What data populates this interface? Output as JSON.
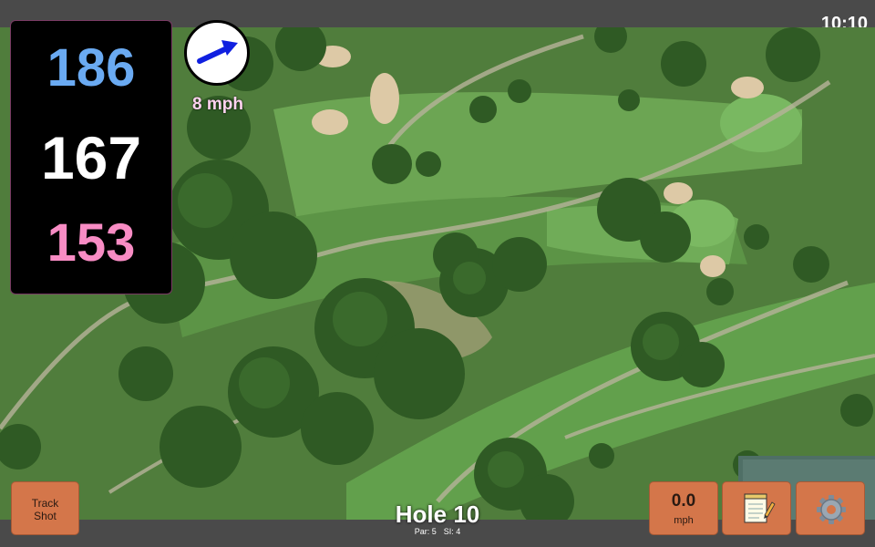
{
  "status_bar": {
    "time": "10:10"
  },
  "distances": {
    "back": "186",
    "middle": "167",
    "front": "153"
  },
  "distance_colors": {
    "back": "#6aaaf2",
    "middle": "#ffffff",
    "front": "#f88cc4"
  },
  "wind": {
    "speed_label": "8 mph",
    "direction_icon": "arrow-icon"
  },
  "hole": {
    "title": "Hole 10",
    "par_label": "Par: 5",
    "si_label": "SI: 4"
  },
  "buttons": {
    "track_shot_label": "Track Shot",
    "speed_value": "0.0",
    "speed_unit": "mph",
    "notes_icon": "notepad-icon",
    "settings_icon": "gear-icon"
  },
  "colors": {
    "button": "#d4764a",
    "panel": "#000000",
    "bar": "#4a4a4a"
  }
}
